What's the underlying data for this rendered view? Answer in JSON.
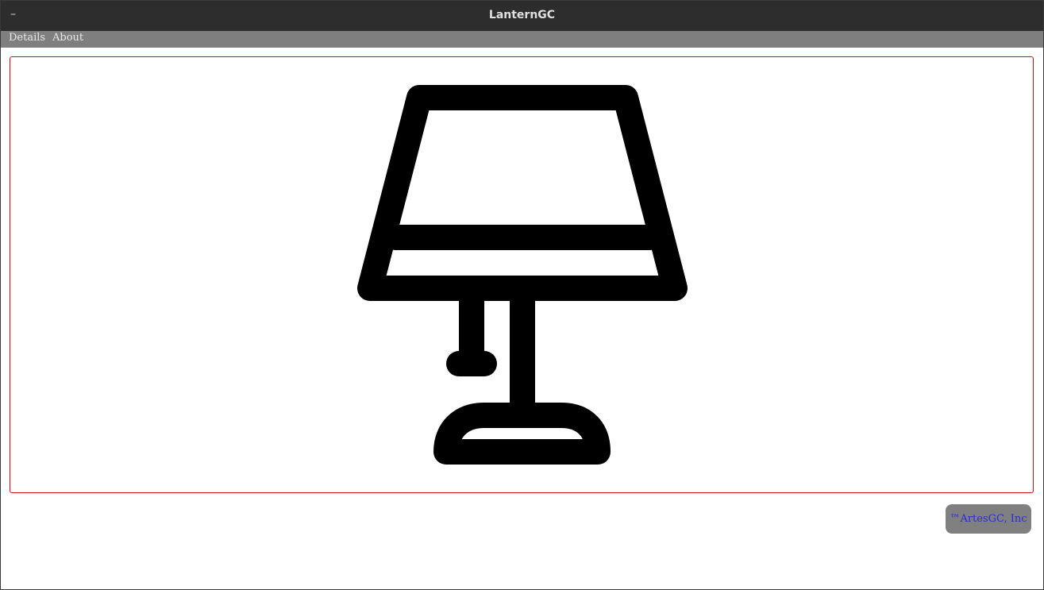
{
  "window": {
    "title": "LanternGC",
    "minimize_glyph": "–"
  },
  "menu": {
    "items": [
      {
        "label": "Details"
      },
      {
        "label": "About"
      }
    ]
  },
  "canvas": {
    "image": "table-lamp-icon",
    "border_color": "#d01010"
  },
  "footer": {
    "brand_label": "™ArtesGC, Inc",
    "brand_text_color": "#2a2ad8",
    "brand_bg_color": "#808080"
  },
  "colors": {
    "titlebar": "#2d2d2d",
    "menubar": "#7f7f7f",
    "icon": "#000000"
  }
}
